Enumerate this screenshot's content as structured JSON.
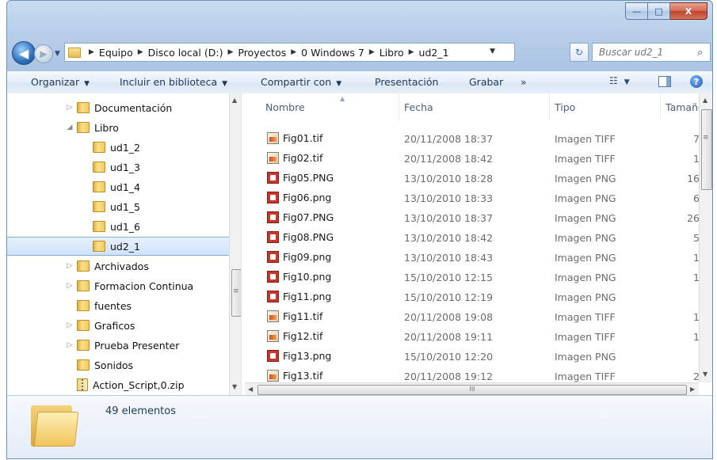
{
  "titlebar": {
    "min_label": "—",
    "max_label": "□",
    "close_label": "X"
  },
  "nav": {
    "back_glyph": "◀",
    "forward_glyph": "▶",
    "history_glyph": "▼"
  },
  "address": {
    "crumbs": [
      "Equipo",
      "Disco local (D:)",
      "Proyectos",
      "0 Windows 7",
      "Libro",
      "ud2_1"
    ],
    "separator": "▶",
    "dropdown_glyph": "▼",
    "refresh_glyph": "↻"
  },
  "search": {
    "placeholder": "Buscar ud2_1",
    "icon": "search-icon"
  },
  "toolbar": {
    "organize": "Organizar",
    "include": "Incluir en biblioteca",
    "share": "Compartir con",
    "presentation": "Presentación",
    "burn": "Grabar",
    "more": "»",
    "views_glyph": "☷",
    "caret": "▼",
    "help": "?"
  },
  "tree": [
    {
      "label": "Documentación",
      "indent": 1,
      "expander": "▷",
      "type": "folder"
    },
    {
      "label": "Libro",
      "indent": 1,
      "expander": "◢",
      "type": "folder"
    },
    {
      "label": "ud1_2",
      "indent": 2,
      "expander": "",
      "type": "folder"
    },
    {
      "label": "ud1_3",
      "indent": 2,
      "expander": "",
      "type": "folder"
    },
    {
      "label": "ud1_4",
      "indent": 2,
      "expander": "",
      "type": "folder"
    },
    {
      "label": "ud1_5",
      "indent": 2,
      "expander": "",
      "type": "folder"
    },
    {
      "label": "ud1_6",
      "indent": 2,
      "expander": "",
      "type": "folder"
    },
    {
      "label": "ud2_1",
      "indent": 2,
      "expander": "",
      "type": "folder",
      "selected": true
    },
    {
      "label": "Archivados",
      "indent": 1,
      "expander": "▷",
      "type": "folder"
    },
    {
      "label": "Formacion Continua",
      "indent": 1,
      "expander": "▷",
      "type": "folder"
    },
    {
      "label": "fuentes",
      "indent": 1,
      "expander": "",
      "type": "folder"
    },
    {
      "label": "Graficos",
      "indent": 1,
      "expander": "▷",
      "type": "folder"
    },
    {
      "label": "Prueba Presenter",
      "indent": 1,
      "expander": "▷",
      "type": "folder"
    },
    {
      "label": "Sonidos",
      "indent": 1,
      "expander": "",
      "type": "folder"
    },
    {
      "label": "Action_Script,0.zip",
      "indent": 1,
      "expander": "",
      "type": "zip"
    }
  ],
  "columns": {
    "name": "Nombre",
    "date": "Fecha",
    "type": "Tipo",
    "size": "Tamaño"
  },
  "files": [
    {
      "name": "Fig01.tif",
      "date": "20/11/2008 18:37",
      "type": "Imagen TIFF",
      "size": "7",
      "icon": "tiff"
    },
    {
      "name": "Fig02.tif",
      "date": "20/11/2008 18:42",
      "type": "Imagen TIFF",
      "size": "1",
      "icon": "tiff"
    },
    {
      "name": "Fig05.PNG",
      "date": "13/10/2010 18:28",
      "type": "Imagen PNG",
      "size": "16",
      "icon": "png"
    },
    {
      "name": "Fig06.png",
      "date": "13/10/2010 18:33",
      "type": "Imagen PNG",
      "size": "6",
      "icon": "png"
    },
    {
      "name": "Fig07.PNG",
      "date": "13/10/2010 18:37",
      "type": "Imagen PNG",
      "size": "26",
      "icon": "png"
    },
    {
      "name": "Fig08.PNG",
      "date": "13/10/2010 18:42",
      "type": "Imagen PNG",
      "size": "5",
      "icon": "png"
    },
    {
      "name": "Fig09.png",
      "date": "13/10/2010 18:43",
      "type": "Imagen PNG",
      "size": "1",
      "icon": "png"
    },
    {
      "name": "Fig10.png",
      "date": "15/10/2010 12:15",
      "type": "Imagen PNG",
      "size": "1",
      "icon": "png"
    },
    {
      "name": "Fig11.png",
      "date": "15/10/2010 12:19",
      "type": "Imagen PNG",
      "size": "",
      "icon": "png"
    },
    {
      "name": "Fig11.tif",
      "date": "20/11/2008 19:08",
      "type": "Imagen TIFF",
      "size": "1",
      "icon": "tiff"
    },
    {
      "name": "Fig12.tif",
      "date": "20/11/2008 19:11",
      "type": "Imagen TIFF",
      "size": "1",
      "icon": "tiff"
    },
    {
      "name": "Fig13.png",
      "date": "15/10/2010 12:20",
      "type": "Imagen PNG",
      "size": "",
      "icon": "png"
    },
    {
      "name": "Fig13.tif",
      "date": "20/11/2008 19:12",
      "type": "Imagen TIFF",
      "size": "2",
      "icon": "tiff"
    }
  ],
  "status": {
    "count": "49 elementos"
  },
  "scroll": {
    "up": "▲",
    "down": "▼",
    "left": "◀",
    "right": "▶",
    "grip": "≡",
    "hgrip": "III"
  }
}
